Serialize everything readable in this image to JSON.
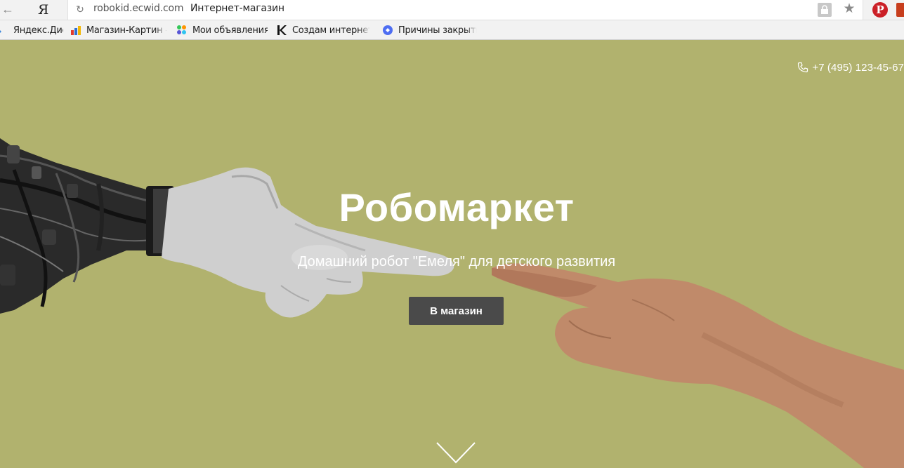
{
  "browser": {
    "url_host": "robokid.ecwid.com",
    "page_title": "Интернет-магазин",
    "yandex_glyph": "Я",
    "pinterest_glyph": "P",
    "bookmarks": [
      {
        "label": "Яндекс.Диск",
        "icon": "yandex-disk-icon"
      },
      {
        "label": "Магазин-Картин –",
        "icon": "bar-chart-icon"
      },
      {
        "label": "Мои объявления",
        "icon": "colored-dots-icon"
      },
      {
        "label": "Создам интернет-",
        "icon": "k-logo-icon"
      },
      {
        "label": "Причины закрытия",
        "icon": "blue-circle-icon"
      }
    ]
  },
  "hero": {
    "phone": "+7 (495) 123-45-67",
    "title": "Робомаркет",
    "subtitle": "Домашний робот \"Емеля\" для детского развития",
    "cta_label": "В магазин",
    "background_color": "#b1b26e",
    "button_color": "#4a4a4a"
  }
}
